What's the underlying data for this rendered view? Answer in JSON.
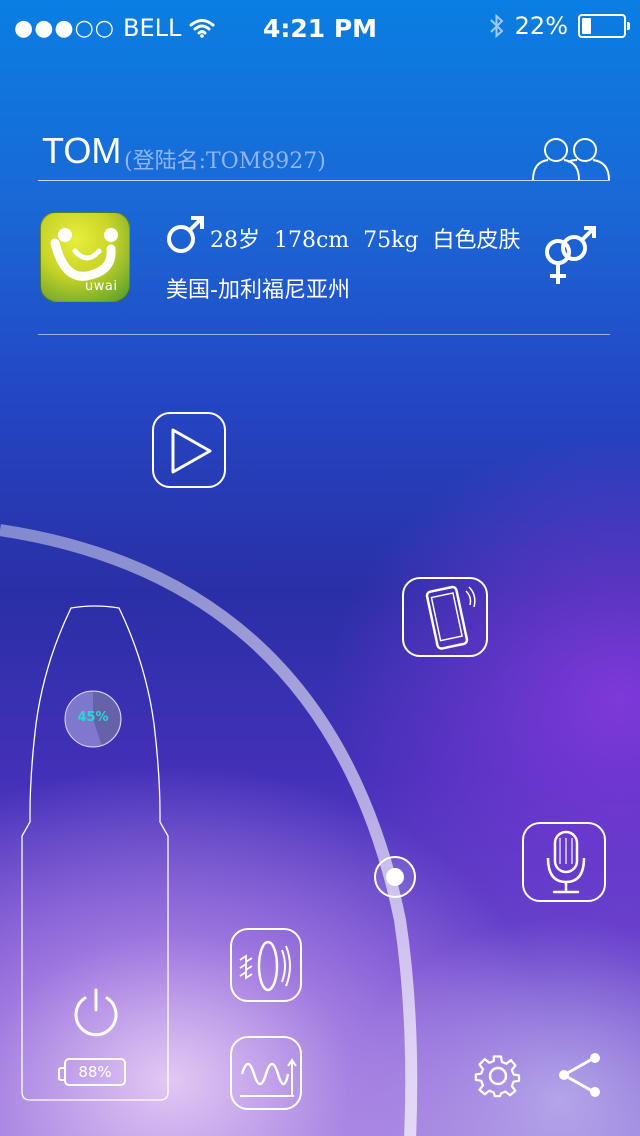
{
  "status_bar": {
    "signal_dots": "●●●○○",
    "carrier": "BELL",
    "time": "4:21 PM",
    "battery_percent": "22%",
    "battery_level": 0.22
  },
  "user": {
    "name": "TOM",
    "login": "(登陆名:TOM8927)",
    "stats": "28岁  178cm  75kg  白色皮肤",
    "location": "美国-加利福尼亚州",
    "logo_text": "uwai"
  },
  "device": {
    "progress_label": "45%",
    "progress_value": 0.45,
    "battery_label": "88%",
    "battery_value": 0.88
  },
  "icons": {
    "people": "people-icon",
    "gender_male": "male-symbol-icon",
    "gender_pair": "gender-pair-icon",
    "play": "play-icon",
    "phone": "phone-icon",
    "microphone": "microphone-icon",
    "vibrate": "vibrate-icon",
    "wave": "wave-icon",
    "power": "power-icon",
    "settings": "settings-icon",
    "share": "share-icon"
  },
  "colors": {
    "progress_accent": "#2ad6d6",
    "top_blue": "#0a7ee2",
    "purple": "#6a44cc"
  }
}
